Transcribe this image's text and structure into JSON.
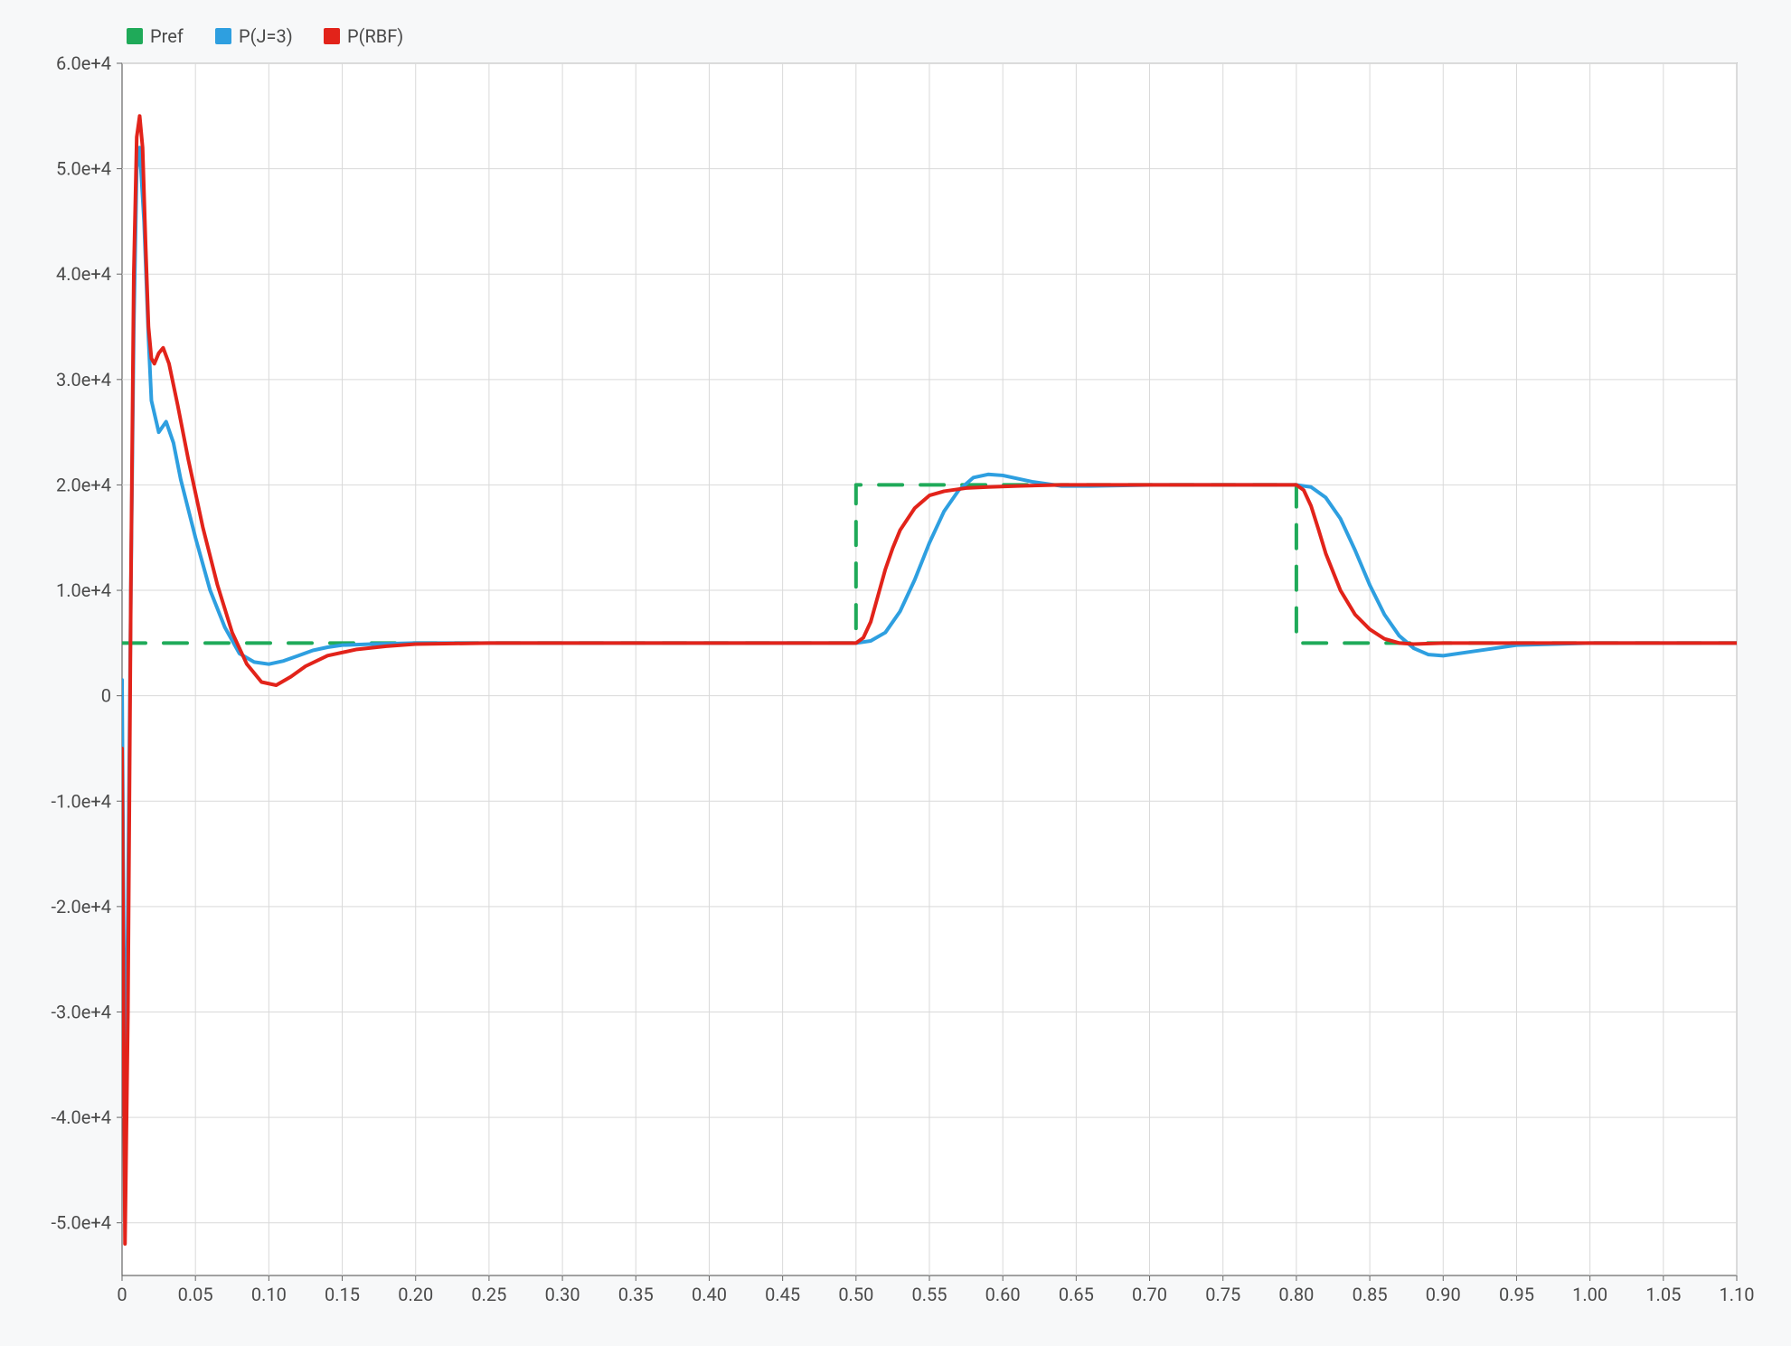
{
  "chart_data": {
    "type": "line",
    "title": "",
    "xlabel": "",
    "ylabel": "",
    "xlim": [
      0,
      1.1
    ],
    "ylim": [
      -55000,
      60000
    ],
    "x_ticks": [
      0,
      0.05,
      0.1,
      0.15,
      0.2,
      0.25,
      0.3,
      0.35,
      0.4,
      0.45,
      0.5,
      0.55,
      0.6,
      0.65,
      0.7,
      0.75,
      0.8,
      0.85,
      0.9,
      0.95,
      1.0,
      1.05,
      1.1
    ],
    "x_tick_labels": [
      "0",
      "0.05",
      "0.10",
      "0.15",
      "0.20",
      "0.25",
      "0.30",
      "0.35",
      "0.40",
      "0.45",
      "0.50",
      "0.55",
      "0.60",
      "0.65",
      "0.70",
      "0.75",
      "0.80",
      "0.85",
      "0.90",
      "0.95",
      "1.00",
      "1.05",
      "1.10"
    ],
    "y_ticks": [
      -50000,
      -40000,
      -30000,
      -20000,
      -10000,
      0,
      10000,
      20000,
      30000,
      40000,
      50000,
      60000
    ],
    "y_tick_labels": [
      "-5.0e+4",
      "-4.0e+4",
      "-3.0e+4",
      "-2.0e+4",
      "-1.0e+4",
      "0",
      "1.0e+4",
      "2.0e+4",
      "3.0e+4",
      "4.0e+4",
      "5.0e+4",
      "6.0e+4"
    ],
    "legend": {
      "position": "top-left",
      "items": [
        {
          "name": "Pref",
          "color": "#1faa59",
          "style": "dashed"
        },
        {
          "name": "P(J=3)",
          "color": "#2e9fe0",
          "style": "solid"
        },
        {
          "name": "P(RBF)",
          "color": "#e2231a",
          "style": "solid"
        }
      ]
    },
    "series": [
      {
        "name": "Pref",
        "color": "#1faa59",
        "style": "dashed",
        "width": 4,
        "x": [
          0.0,
          0.005,
          0.005,
          0.5,
          0.5,
          0.8,
          0.8,
          1.1
        ],
        "y": [
          5000,
          5000,
          5000,
          5000,
          20000,
          20000,
          5000,
          5000
        ]
      },
      {
        "name": "P(J=3)",
        "color": "#2e9fe0",
        "style": "solid",
        "width": 4,
        "x": [
          0.0,
          0.002,
          0.004,
          0.006,
          0.008,
          0.01,
          0.012,
          0.015,
          0.018,
          0.02,
          0.025,
          0.03,
          0.035,
          0.04,
          0.05,
          0.06,
          0.07,
          0.08,
          0.09,
          0.1,
          0.11,
          0.12,
          0.13,
          0.14,
          0.15,
          0.17,
          0.2,
          0.25,
          0.3,
          0.4,
          0.5,
          0.51,
          0.52,
          0.53,
          0.54,
          0.55,
          0.56,
          0.57,
          0.58,
          0.59,
          0.6,
          0.62,
          0.64,
          0.66,
          0.7,
          0.75,
          0.8,
          0.81,
          0.82,
          0.83,
          0.84,
          0.85,
          0.86,
          0.87,
          0.88,
          0.89,
          0.9,
          0.92,
          0.95,
          1.0,
          1.1
        ],
        "y": [
          1500,
          -42000,
          -20000,
          10000,
          35000,
          50000,
          52000,
          45000,
          34000,
          28000,
          25000,
          26000,
          24000,
          20500,
          15000,
          10000,
          6500,
          4000,
          3200,
          3000,
          3300,
          3800,
          4300,
          4600,
          4800,
          4900,
          5000,
          5000,
          5000,
          5000,
          5000,
          5200,
          6000,
          8000,
          11000,
          14500,
          17500,
          19500,
          20700,
          21000,
          20900,
          20300,
          19900,
          19900,
          20000,
          20000,
          20000,
          19800,
          18800,
          16800,
          13800,
          10500,
          7700,
          5700,
          4500,
          3900,
          3800,
          4200,
          4800,
          5000,
          5000
        ]
      },
      {
        "name": "P(RBF)",
        "color": "#e2231a",
        "style": "solid",
        "width": 4,
        "x": [
          0.0,
          0.002,
          0.004,
          0.006,
          0.008,
          0.01,
          0.012,
          0.014,
          0.016,
          0.018,
          0.02,
          0.022,
          0.025,
          0.028,
          0.032,
          0.038,
          0.045,
          0.055,
          0.065,
          0.075,
          0.085,
          0.095,
          0.105,
          0.115,
          0.125,
          0.14,
          0.16,
          0.18,
          0.2,
          0.25,
          0.3,
          0.4,
          0.5,
          0.505,
          0.51,
          0.515,
          0.52,
          0.525,
          0.53,
          0.54,
          0.55,
          0.56,
          0.575,
          0.59,
          0.61,
          0.64,
          0.68,
          0.75,
          0.8,
          0.805,
          0.81,
          0.815,
          0.82,
          0.83,
          0.84,
          0.85,
          0.86,
          0.87,
          0.88,
          0.9,
          0.95,
          1.0,
          1.1
        ],
        "y": [
          -5000,
          -52000,
          -30000,
          10000,
          40000,
          53000,
          55000,
          52000,
          43000,
          35000,
          32000,
          31500,
          32500,
          33000,
          31500,
          27500,
          22500,
          16000,
          10500,
          6000,
          3000,
          1300,
          1000,
          1800,
          2800,
          3800,
          4400,
          4700,
          4900,
          5000,
          5000,
          5000,
          5000,
          5500,
          7000,
          9500,
          12000,
          14000,
          15700,
          17800,
          19000,
          19400,
          19700,
          19800,
          19900,
          20000,
          20000,
          20000,
          20000,
          19500,
          18000,
          15800,
          13500,
          10000,
          7700,
          6300,
          5400,
          5000,
          4900,
          5000,
          5000,
          5000,
          5000
        ]
      }
    ]
  }
}
